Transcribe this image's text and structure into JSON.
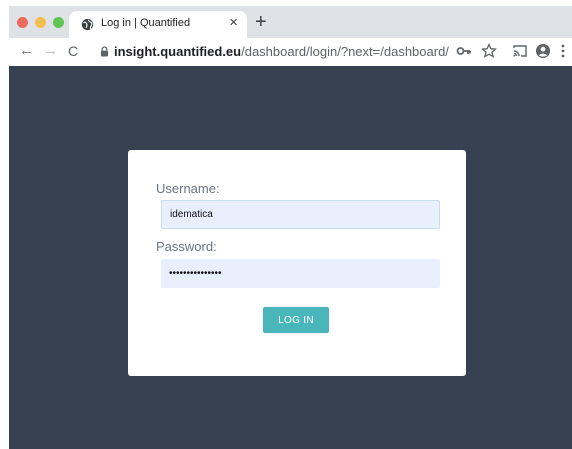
{
  "browser": {
    "tab": {
      "title": "Log in | Quantified",
      "close_glyph": "×"
    },
    "new_tab_glyph": "+",
    "nav": {
      "back_glyph": "←",
      "forward_glyph": "→",
      "reload_glyph": "C"
    },
    "url": {
      "host": "insight.quantified.eu",
      "path": "/dashboard/login/?next=/dashboard/"
    },
    "icons": [
      "globe-icon",
      "lock-icon",
      "key-icon",
      "star-icon",
      "cast-icon",
      "account-icon",
      "kebab-menu-icon"
    ]
  },
  "login": {
    "username_label": "Username:",
    "username_value": "idematica",
    "password_label": "Password:",
    "password_value": "•••••••••••••••",
    "submit_label": "LOG IN"
  },
  "colors": {
    "page_background": "#374152",
    "accent_button": "#49b6bb",
    "input_autofill": "#e8f0fe"
  }
}
